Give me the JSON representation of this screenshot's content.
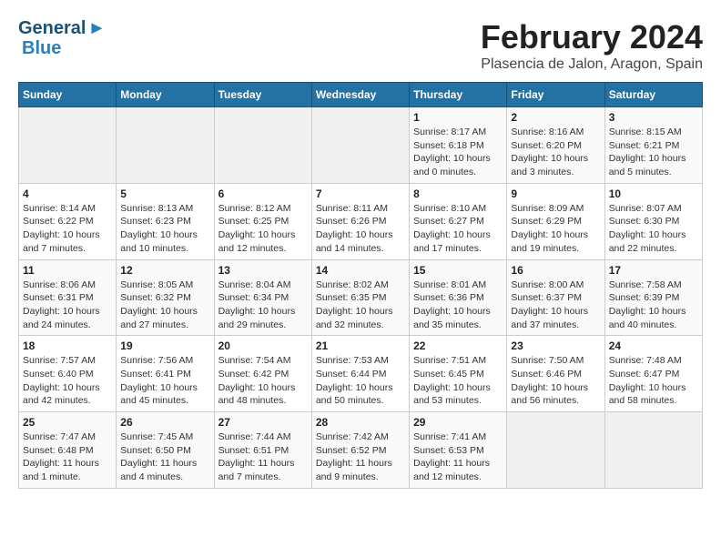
{
  "logo": {
    "general": "General",
    "blue": "Blue"
  },
  "title": "February 2024",
  "subtitle": "Plasencia de Jalon, Aragon, Spain",
  "days_of_week": [
    "Sunday",
    "Monday",
    "Tuesday",
    "Wednesday",
    "Thursday",
    "Friday",
    "Saturday"
  ],
  "weeks": [
    [
      {
        "day": "",
        "info": ""
      },
      {
        "day": "",
        "info": ""
      },
      {
        "day": "",
        "info": ""
      },
      {
        "day": "",
        "info": ""
      },
      {
        "day": "1",
        "info": "Sunrise: 8:17 AM\nSunset: 6:18 PM\nDaylight: 10 hours and 0 minutes."
      },
      {
        "day": "2",
        "info": "Sunrise: 8:16 AM\nSunset: 6:20 PM\nDaylight: 10 hours and 3 minutes."
      },
      {
        "day": "3",
        "info": "Sunrise: 8:15 AM\nSunset: 6:21 PM\nDaylight: 10 hours and 5 minutes."
      }
    ],
    [
      {
        "day": "4",
        "info": "Sunrise: 8:14 AM\nSunset: 6:22 PM\nDaylight: 10 hours and 7 minutes."
      },
      {
        "day": "5",
        "info": "Sunrise: 8:13 AM\nSunset: 6:23 PM\nDaylight: 10 hours and 10 minutes."
      },
      {
        "day": "6",
        "info": "Sunrise: 8:12 AM\nSunset: 6:25 PM\nDaylight: 10 hours and 12 minutes."
      },
      {
        "day": "7",
        "info": "Sunrise: 8:11 AM\nSunset: 6:26 PM\nDaylight: 10 hours and 14 minutes."
      },
      {
        "day": "8",
        "info": "Sunrise: 8:10 AM\nSunset: 6:27 PM\nDaylight: 10 hours and 17 minutes."
      },
      {
        "day": "9",
        "info": "Sunrise: 8:09 AM\nSunset: 6:29 PM\nDaylight: 10 hours and 19 minutes."
      },
      {
        "day": "10",
        "info": "Sunrise: 8:07 AM\nSunset: 6:30 PM\nDaylight: 10 hours and 22 minutes."
      }
    ],
    [
      {
        "day": "11",
        "info": "Sunrise: 8:06 AM\nSunset: 6:31 PM\nDaylight: 10 hours and 24 minutes."
      },
      {
        "day": "12",
        "info": "Sunrise: 8:05 AM\nSunset: 6:32 PM\nDaylight: 10 hours and 27 minutes."
      },
      {
        "day": "13",
        "info": "Sunrise: 8:04 AM\nSunset: 6:34 PM\nDaylight: 10 hours and 29 minutes."
      },
      {
        "day": "14",
        "info": "Sunrise: 8:02 AM\nSunset: 6:35 PM\nDaylight: 10 hours and 32 minutes."
      },
      {
        "day": "15",
        "info": "Sunrise: 8:01 AM\nSunset: 6:36 PM\nDaylight: 10 hours and 35 minutes."
      },
      {
        "day": "16",
        "info": "Sunrise: 8:00 AM\nSunset: 6:37 PM\nDaylight: 10 hours and 37 minutes."
      },
      {
        "day": "17",
        "info": "Sunrise: 7:58 AM\nSunset: 6:39 PM\nDaylight: 10 hours and 40 minutes."
      }
    ],
    [
      {
        "day": "18",
        "info": "Sunrise: 7:57 AM\nSunset: 6:40 PM\nDaylight: 10 hours and 42 minutes."
      },
      {
        "day": "19",
        "info": "Sunrise: 7:56 AM\nSunset: 6:41 PM\nDaylight: 10 hours and 45 minutes."
      },
      {
        "day": "20",
        "info": "Sunrise: 7:54 AM\nSunset: 6:42 PM\nDaylight: 10 hours and 48 minutes."
      },
      {
        "day": "21",
        "info": "Sunrise: 7:53 AM\nSunset: 6:44 PM\nDaylight: 10 hours and 50 minutes."
      },
      {
        "day": "22",
        "info": "Sunrise: 7:51 AM\nSunset: 6:45 PM\nDaylight: 10 hours and 53 minutes."
      },
      {
        "day": "23",
        "info": "Sunrise: 7:50 AM\nSunset: 6:46 PM\nDaylight: 10 hours and 56 minutes."
      },
      {
        "day": "24",
        "info": "Sunrise: 7:48 AM\nSunset: 6:47 PM\nDaylight: 10 hours and 58 minutes."
      }
    ],
    [
      {
        "day": "25",
        "info": "Sunrise: 7:47 AM\nSunset: 6:48 PM\nDaylight: 11 hours and 1 minute."
      },
      {
        "day": "26",
        "info": "Sunrise: 7:45 AM\nSunset: 6:50 PM\nDaylight: 11 hours and 4 minutes."
      },
      {
        "day": "27",
        "info": "Sunrise: 7:44 AM\nSunset: 6:51 PM\nDaylight: 11 hours and 7 minutes."
      },
      {
        "day": "28",
        "info": "Sunrise: 7:42 AM\nSunset: 6:52 PM\nDaylight: 11 hours and 9 minutes."
      },
      {
        "day": "29",
        "info": "Sunrise: 7:41 AM\nSunset: 6:53 PM\nDaylight: 11 hours and 12 minutes."
      },
      {
        "day": "",
        "info": ""
      },
      {
        "day": "",
        "info": ""
      }
    ]
  ]
}
